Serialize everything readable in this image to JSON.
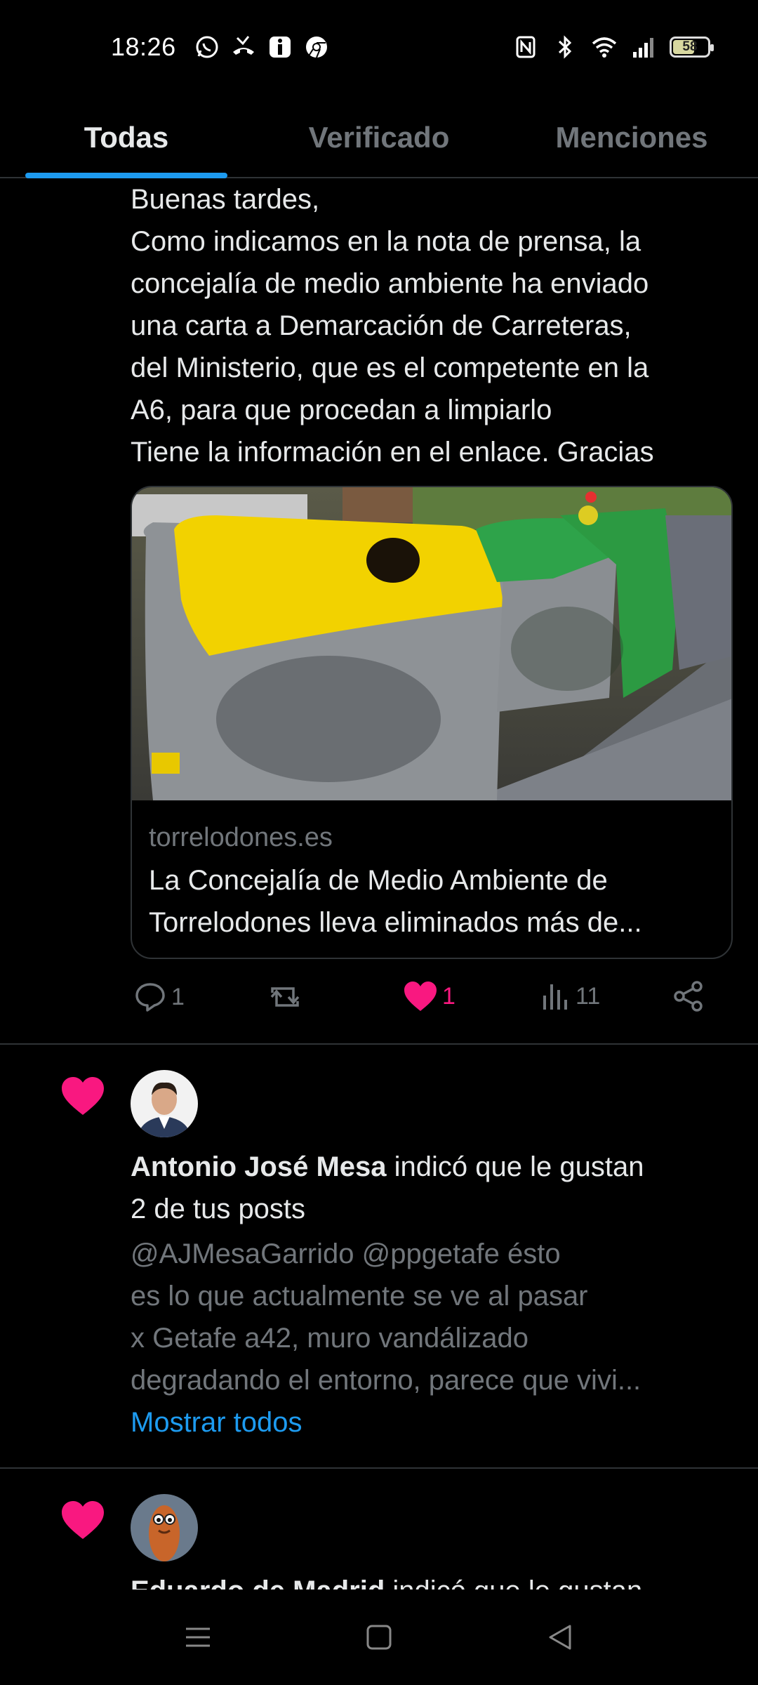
{
  "status_bar": {
    "time": "18:26",
    "left_icons": [
      "whatsapp-icon",
      "missed-call-icon",
      "info-app-icon",
      "chrome-icon"
    ],
    "right_icons": [
      "nfc-icon",
      "bluetooth-icon",
      "wifi-icon",
      "signal-icon"
    ],
    "battery_level": "58"
  },
  "tabs": [
    {
      "label": "Todas",
      "active": true
    },
    {
      "label": "Verificado",
      "active": false
    },
    {
      "label": "Menciones",
      "active": false
    }
  ],
  "post": {
    "lines": [
      "Buenas tardes,",
      "Como indicamos en la nota de prensa, la",
      "concejalía de medio ambiente ha enviado",
      "una carta a Demarcación de Carreteras,",
      "del Ministerio, que es el competente en la",
      "A6, para que procedan a limpiarlo",
      "Tiene la información en el enlace. Gracias"
    ],
    "card": {
      "domain": "torrelodones.es",
      "title_lines": [
        "La Concejalía de Medio Ambiente de",
        "Torrelodones lleva eliminados más de..."
      ]
    },
    "actions": {
      "replies": "1",
      "reposts": "",
      "likes": "1",
      "views": "11"
    }
  },
  "notifications": [
    {
      "name": "Antonio José Mesa",
      "text_after_name": " indicó que le gustan",
      "text_line2": "2 de tus posts",
      "quote_lines": [
        "@AJMesaGarrido @ppgetafe ésto",
        "es lo que actualmente se ve al pasar",
        "x Getafe a42, muro vandálizado",
        "degradando el entorno, parece que vivi..."
      ],
      "show_all": "Mostrar todos"
    },
    {
      "name": "Eduardo de Madrid",
      "text_after_name": " indicó que le gustan"
    }
  ],
  "colors": {
    "accent": "#1d9bf0",
    "like": "#f91880",
    "muted": "#71767b",
    "divider": "#2f3336"
  }
}
